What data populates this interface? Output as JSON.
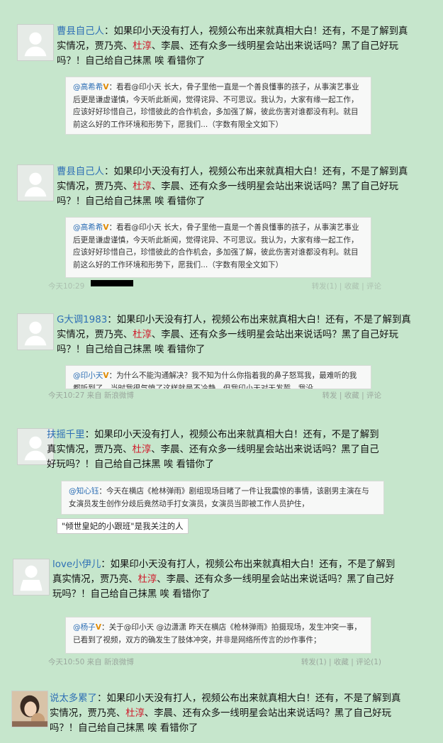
{
  "posts": [
    {
      "user": "曹县自己人",
      "sep": "：",
      "body_a": "如果印小天没有打人，视频公布出来就真相大白！还有，不是了解到真实情况，贾乃亮、",
      "red": "杜淳",
      "body_b": "、李晨、还有众多一线明星会站出来说话吗？黑了自己好玩吗？！自己给自己抹黑 唉 看错你了",
      "quote_user": "@高希希",
      "quote_text": "：看看@印小天 长大，骨子里他一直是一个善良懂事的孩子，从事演艺事业后更是谦虚谨慎，今天听此新闻，觉得诧异、不可思议。我认为，大家有缘一起工作，应该好好珍惜自己，珍惜彼此的合作机会，多加强了解，彼此伤害对谁都没有利。就目前这么好的工作环境和形势下，愿我们...（字数有限全文如下）",
      "meta_left": "",
      "meta_right": ""
    },
    {
      "user": "曹县自己人",
      "sep": "：",
      "body_a": "如果印小天没有打人，视频公布出来就真相大白！还有，不是了解到真实情况，贾乃亮、",
      "red": "杜淳",
      "body_b": "、李晨、还有众多一线明星会站出来说话吗？黑了自己好玩吗？！自己给自己抹黑 唉 看错你了",
      "quote_user": "@高希希",
      "quote_text": "：看看@印小天 长大，骨子里他一直是一个善良懂事的孩子，从事演艺事业后更是谦虚谨慎，今天听此新闻，觉得诧异、不可思议。我认为，大家有缘一起工作，应该好好珍惜自己，珍惜彼此的合作机会，多加强了解，彼此伤害对谁都没有利。就目前这么好的工作环境和形势下，愿我们...（字数有限全文如下）",
      "meta_left": "今天10:29",
      "meta_right": "转发(1) | 收藏 | 评论"
    },
    {
      "user": "G大调1983",
      "sep": "：",
      "body_a": "如果印小天没有打人，视频公布出来就真相大白！还有，不是了解到真实情况，贾乃亮、",
      "red": "杜淳",
      "body_b": "、李晨、还有众多一线明星会站出来说话吗？黑了自己好玩吗？！自己给自己抹黑 唉 看错你了",
      "quote_user": "@印小天",
      "quote_text": "：为什么不能沟通解决？我不知为什么你指着我的鼻子怒骂我，最难听的我都听到了，当时我很气愤了这样就是不冷静，但我印小天对天发誓，我没",
      "meta_left": "今天10:27    来自 新浪微博",
      "meta_right": "转发 | 收藏 | 评论"
    },
    {
      "user": "扶摇千里",
      "sep": "：",
      "body_a": "如果印小天没有打人，视频公布出来就真相大白！还有，不是了解到真实情况，贾乃亮、",
      "red": "杜淳",
      "body_b": "、李晨、还有众多一线明星会站出来说话吗？黑了自己好玩吗？！自己给自己抹黑 唉 看错你了",
      "quote_user": "@知心钰",
      "quote_text": "：今天在横店《枪林弹雨》剧组现场目睹了一件让我震惊的事情，该剧男主演在与女演员发生创作分歧后竟然动手打女演员，女演员当即被工作人员护住，",
      "meta_left": "",
      "meta_right": "",
      "tag": "\"倾世皇妃的小跟班\"是我关注的人"
    },
    {
      "user": "love小伊儿",
      "sep": "：",
      "body_a": "如果印小天没有打人，视频公布出来就真相大白！还有，不是了解到真实情况，贾乃亮、",
      "red": "杜淳",
      "body_b": "、李晨、还有众多一线明星会站出来说话吗？黑了自己好玩吗？！自己给自己抹黑 唉 看错你了",
      "quote_user": "@杨子",
      "quote_text": "：关于@印小天 @边潇潇 昨天在横店《枪林弹雨》拍摄现场，发生冲突一事，已看到了视频，双方的确发生了肢体冲突，并非是网络所传言的炒作事件；",
      "meta_left": "今天10:50    来自 新浪微博",
      "meta_right": "转发(1) | 收藏 | 评论(1)"
    },
    {
      "user": "说太多累了",
      "sep": "：",
      "body_a": "如果印小天没有打人，视频公布出来就真相大白！还有，不是了解到真实情况，贾乃亮、",
      "red": "杜淳",
      "body_b": "、李晨、还有众多一线明星会站出来说话吗？黑了自己好玩吗？！自己给自己抹黑 唉 看错你了",
      "quote_user": "",
      "quote_text": "",
      "meta_left": "",
      "meta_right": ""
    }
  ]
}
